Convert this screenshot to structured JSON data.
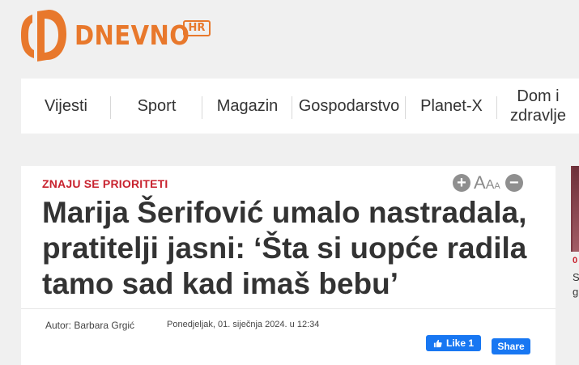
{
  "brand": {
    "name": "DNEVNO",
    "tld": "HR",
    "color": "#e8782c"
  },
  "nav": {
    "items": [
      {
        "label": "Vijesti"
      },
      {
        "label": "Sport"
      },
      {
        "label": "Magazin"
      },
      {
        "label": "Gospodarstvo"
      },
      {
        "label": "Planet-X"
      },
      {
        "label": "Dom i zdravlje"
      }
    ]
  },
  "article": {
    "kicker": "ZNAJU SE PRIORITETI",
    "headline": "Marija Šerifović umalo nastradala, pratitelji jasni: ‘Šta si uopće radila tamo sad kad imaš bebu’",
    "author": "Autor: Barbara Grgić",
    "date": "Ponedjeljak, 01. siječnja 2024. u 12:34",
    "font_tools": {
      "increase_icon": "plus-circle-icon",
      "decrease_icon": "minus-circle-icon",
      "size_glyphs": [
        "A",
        "A",
        "A"
      ]
    },
    "social": {
      "like_label": "Like 1",
      "share_label": "Share",
      "fb_color": "#1877f2"
    },
    "kicker_color": "#c8222e"
  },
  "sidebar": {
    "kicker": "0",
    "title": "S g"
  }
}
